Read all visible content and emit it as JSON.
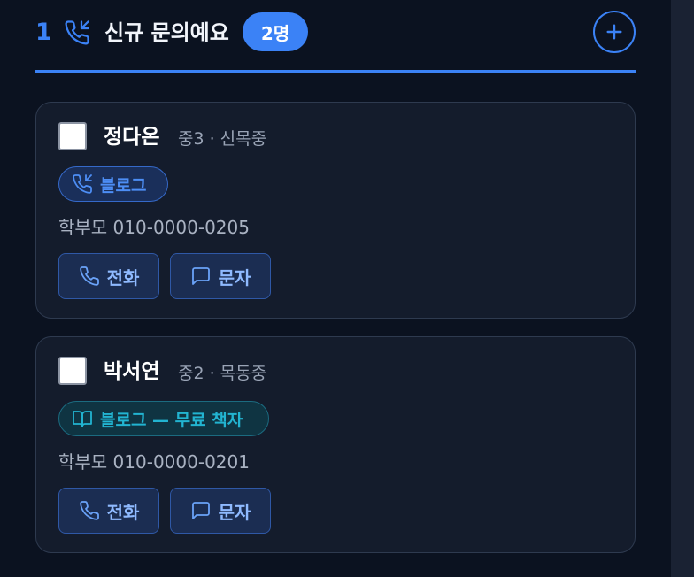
{
  "column": {
    "index": "1",
    "icon": "incoming-call-icon",
    "title": "신규 문의예요",
    "count_badge": "2명",
    "add_icon": "plus-icon"
  },
  "cards": [
    {
      "name": "정다온",
      "meta": "중3 · 신목중",
      "source": {
        "label": "블로그",
        "icon": "incoming-call-icon",
        "color": "#4d8ef5"
      },
      "phone": "학부모 010-0000-0205",
      "actions": {
        "call": "전화",
        "message": "문자"
      }
    },
    {
      "name": "박서연",
      "meta": "중2 · 목동중",
      "source": {
        "label": "블로그 — 무료 책자",
        "icon": "book-open-icon",
        "color": "#22b4d1"
      },
      "phone": "학부모 010-0000-0201",
      "actions": {
        "call": "전화",
        "message": "문자"
      }
    }
  ],
  "colors": {
    "accent": "#3b82f6",
    "background": "#0b1220",
    "card": "#141c2c"
  }
}
